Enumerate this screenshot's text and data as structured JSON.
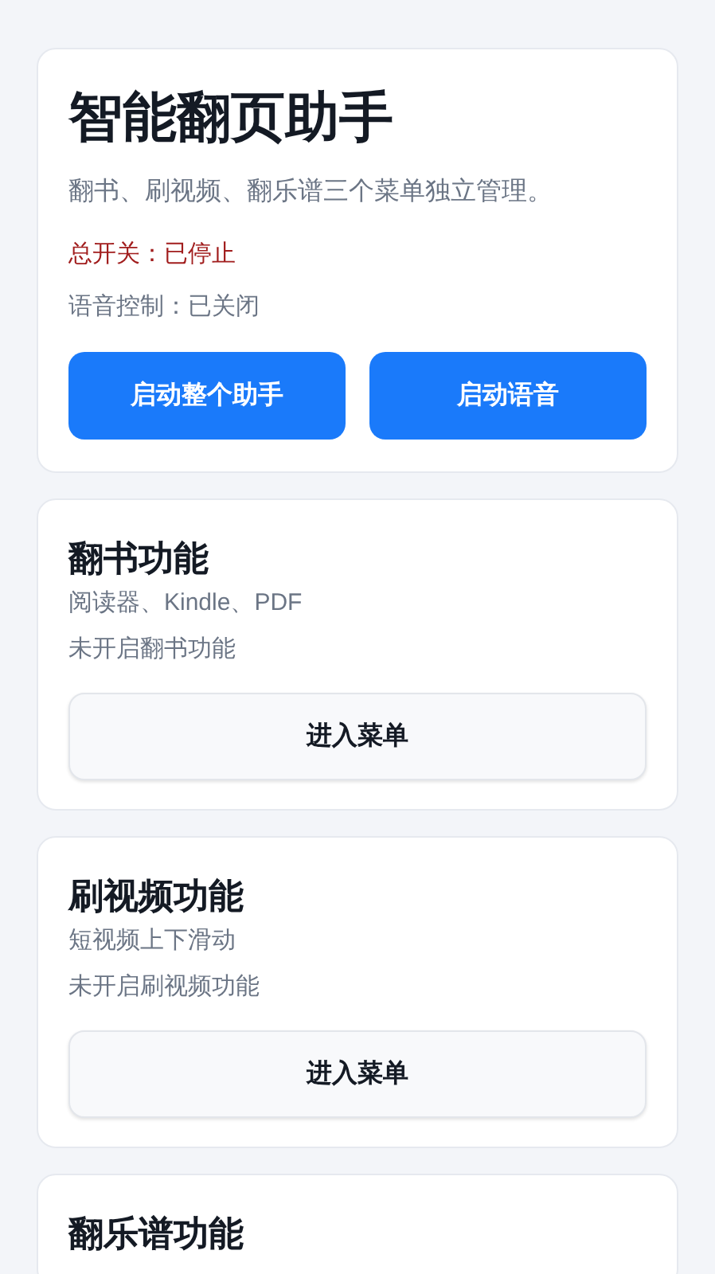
{
  "header": {
    "title": "智能翻页助手",
    "description": "翻书、刷视频、翻乐谱三个菜单独立管理。",
    "master_status": {
      "text": "总开关：已停止",
      "on": false
    },
    "voice_status": {
      "text": "语音控制：已关闭",
      "on": false
    },
    "buttons": [
      "启动整个助手",
      "启动语音"
    ]
  },
  "features": [
    {
      "title": "翻书功能",
      "subtitle": "阅读器、Kindle、PDF",
      "status": "未开启翻书功能",
      "button": "进入菜单"
    },
    {
      "title": "刷视频功能",
      "subtitle": "短视频上下滑动",
      "status": "未开启刷视频功能",
      "button": "进入菜单"
    },
    {
      "title": "翻乐谱功能"
    }
  ]
}
